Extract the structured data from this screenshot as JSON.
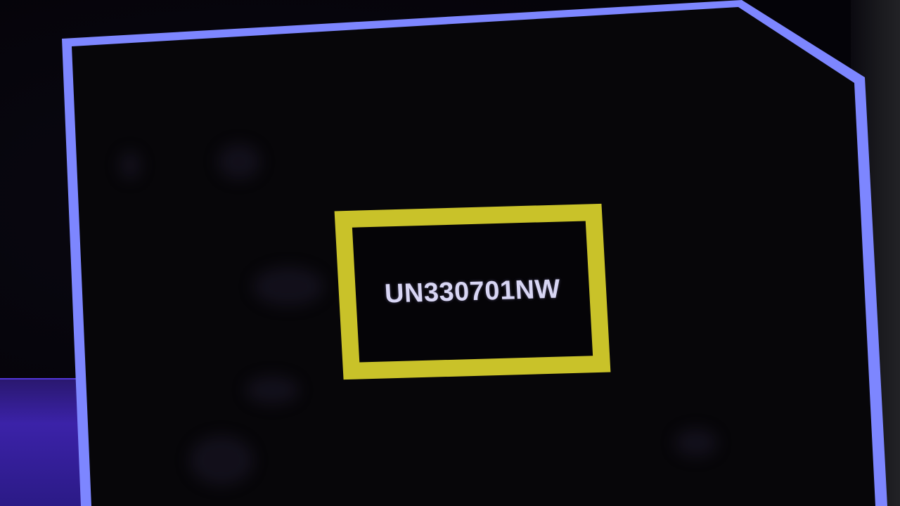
{
  "label": {
    "code": "UN330701NW"
  },
  "colors": {
    "screen_border": "#7d86ff",
    "label_frame": "#c9c229",
    "label_text": "#d8d6f4",
    "background": "#040308"
  }
}
